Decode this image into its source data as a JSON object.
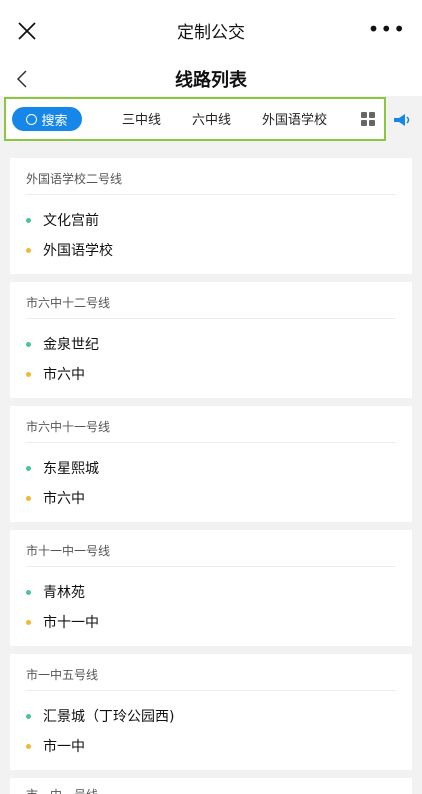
{
  "app": {
    "title": "定制公交"
  },
  "page": {
    "title": "线路列表"
  },
  "tabs": {
    "search_label": "搜索",
    "items": [
      "三中线",
      "六中线",
      "外国语学校"
    ]
  },
  "colors": {
    "start_dot": "#4cc2a5",
    "end_dot": "#f2b733",
    "accent": "#1687e8"
  },
  "routes": [
    {
      "name": "外国语学校二号线",
      "start": "文化宫前",
      "end": "外国语学校"
    },
    {
      "name": "市六中十二号线",
      "start": "金泉世纪",
      "end": "市六中"
    },
    {
      "name": "市六中十一号线",
      "start": "东星熙城",
      "end": "市六中"
    },
    {
      "name": "市十一中一号线",
      "start": "青林苑",
      "end": "市十一中"
    },
    {
      "name": "市一中五号线",
      "start": "汇景城（丁玲公园西)",
      "end": "市一中"
    },
    {
      "name": "市一中一号线"
    }
  ]
}
